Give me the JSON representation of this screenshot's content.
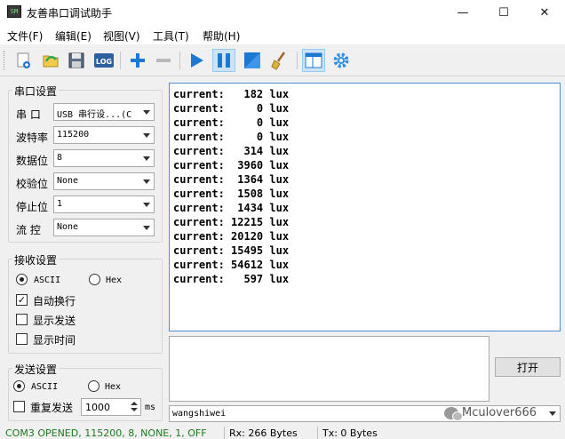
{
  "window": {
    "title": "友善串口调试助手",
    "app_icon_text": "SM",
    "minimize": "—",
    "maximize": "☐",
    "close": "✕"
  },
  "menu": [
    "文件(F)",
    "编辑(E)",
    "视图(V)",
    "工具(T)",
    "帮助(H)"
  ],
  "toolbar": {
    "icons": [
      "new-icon",
      "open-icon",
      "save-icon",
      "log-icon",
      "add-icon",
      "remove-icon",
      "play-icon",
      "pause-icon",
      "stop-icon",
      "clear-icon",
      "layout-icon",
      "settings-icon"
    ],
    "log_text": "LOG"
  },
  "serial_settings": {
    "title": "串口设置",
    "port_label": "串  口",
    "port_value": "USB 串行设...(C",
    "baud_label": "波特率",
    "baud_value": "115200",
    "databits_label": "数据位",
    "databits_value": "8",
    "parity_label": "校验位",
    "parity_value": "None",
    "stopbits_label": "停止位",
    "stopbits_value": "1",
    "flow_label": "流  控",
    "flow_value": "None"
  },
  "receive_settings": {
    "title": "接收设置",
    "ascii_label": "ASCII",
    "hex_label": "Hex",
    "mode": "ASCII",
    "auto_wrap_label": "自动换行",
    "auto_wrap": true,
    "show_send_label": "显示发送",
    "show_send": false,
    "show_time_label": "显示时间",
    "show_time": false
  },
  "send_settings": {
    "title": "发送设置",
    "ascii_label": "ASCII",
    "hex_label": "Hex",
    "mode": "ASCII",
    "repeat_label": "重复发送",
    "repeat": false,
    "interval": "1000",
    "unit": "ms"
  },
  "receive_area": {
    "lines": [
      "current:   182 lux",
      "current:     0 lux",
      "current:     0 lux",
      "current:     0 lux",
      "current:   314 lux",
      "current:  3960 lux",
      "current:  1364 lux",
      "current:  1508 lux",
      "current:  1434 lux",
      "current: 12215 lux",
      "current: 20120 lux",
      "current: 15495 lux",
      "current: 54612 lux",
      "current:   597 lux"
    ]
  },
  "send_area": {
    "open_button": "打开",
    "history_value": "wangshiwei"
  },
  "watermark": "Mculover666",
  "status": {
    "port_state": "COM3 OPENED, 115200, 8, NONE, 1, OFF",
    "rx": "Rx: 266 Bytes",
    "tx": "Tx: 0 Bytes"
  },
  "colors": {
    "status_green": "#1c7a1c",
    "accent_blue": "#1e78d2",
    "rx_border": "#4d8fd6"
  }
}
